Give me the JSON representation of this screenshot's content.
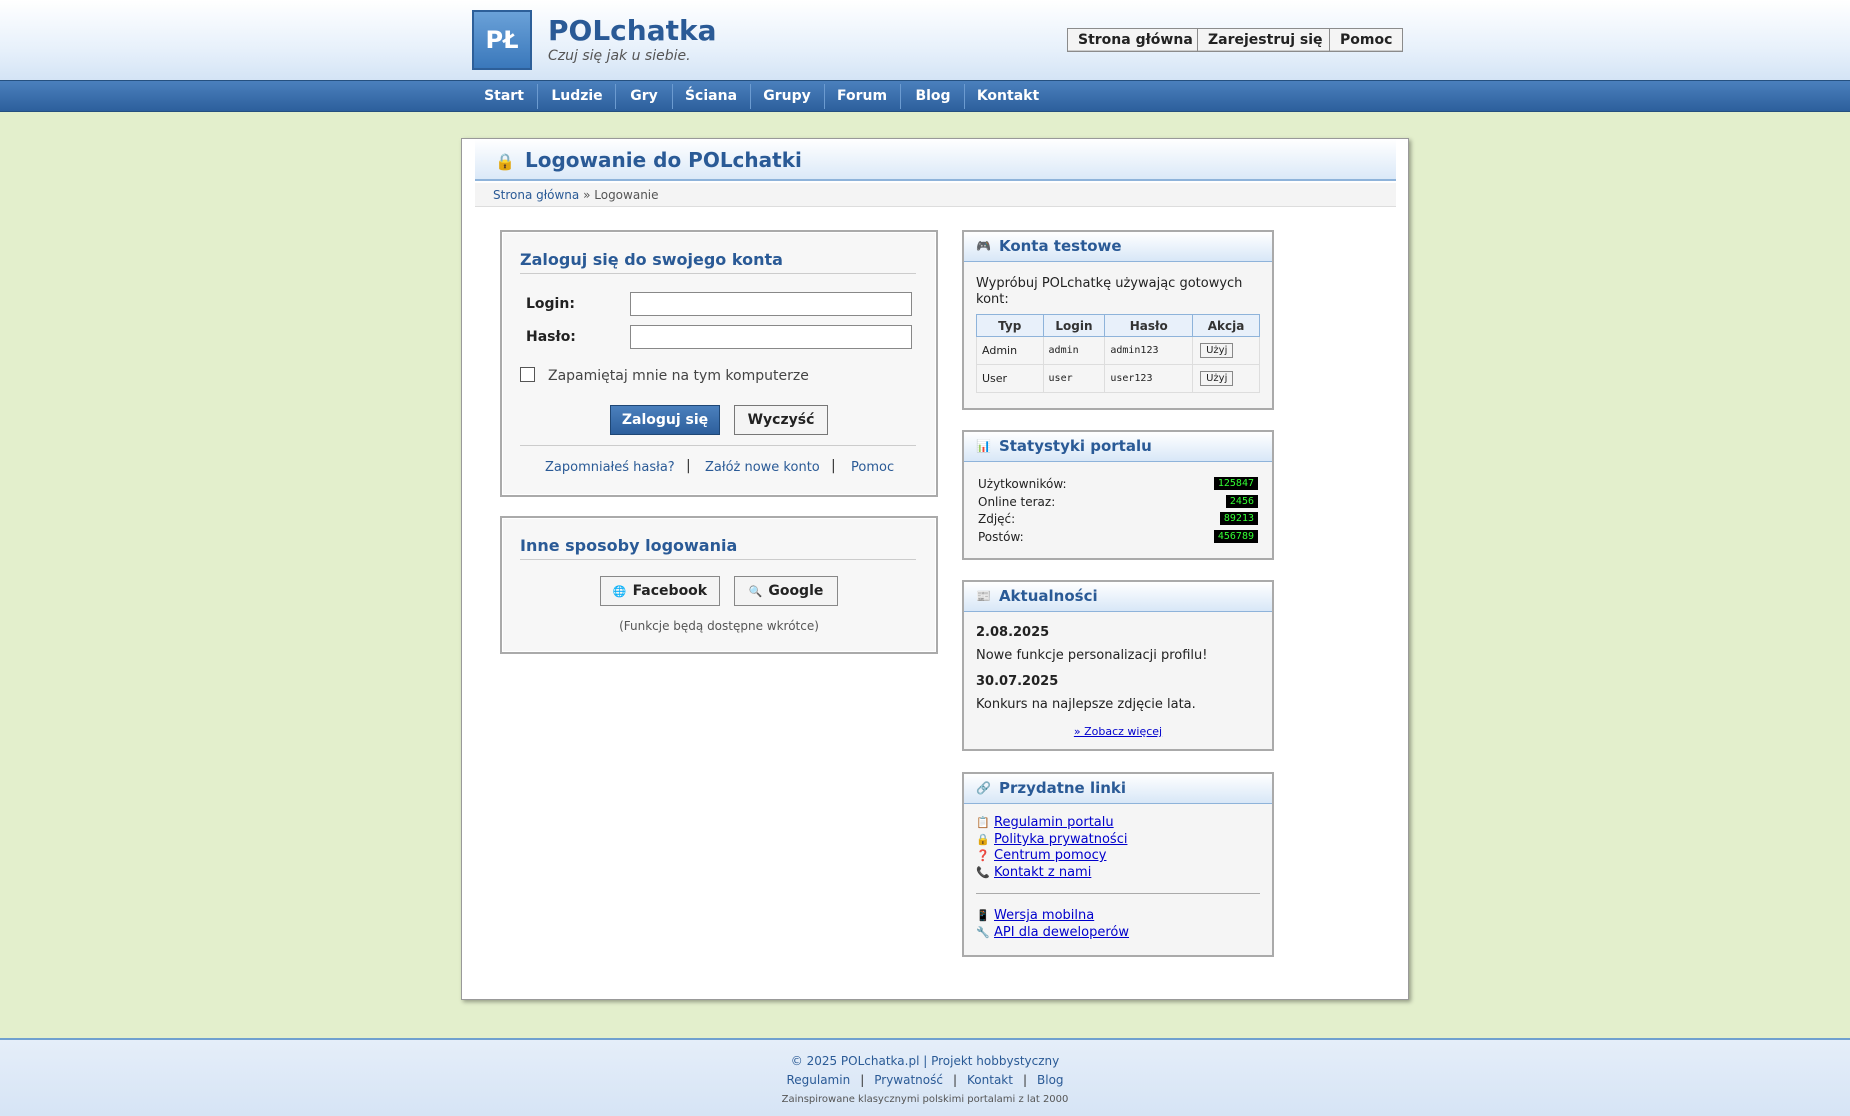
{
  "header": {
    "logo_text": "PŁ",
    "brand": "POLchatka",
    "slogan": "Czuj się jak u siebie.",
    "buttons": [
      "Strona główna",
      "Zarejestruj się",
      "Pomoc"
    ]
  },
  "nav": [
    "Start",
    "Ludzie",
    "Gry",
    "Ściana",
    "Grupy",
    "Forum",
    "Blog",
    "Kontakt"
  ],
  "page": {
    "title_icon": "lock-icon",
    "title": "Logowanie do POLchatki",
    "breadcrumb_home": "Strona główna",
    "breadcrumb_sep": "»",
    "breadcrumb_current": "Logowanie"
  },
  "login": {
    "heading": "Zaloguj się do swojego konta",
    "login_label": "Login:",
    "login_value": "",
    "password_label": "Hasło:",
    "password_value": "",
    "remember_label": "Zapamiętaj mnie na tym komputerze",
    "remember_checked": false,
    "submit": "Zaloguj się",
    "clear": "Wyczyść",
    "links": [
      "Zapomniałeś hasła?",
      "Załóż nowe konto",
      "Pomoc"
    ],
    "link_sep": "|"
  },
  "other_login": {
    "heading": "Inne sposoby logowania",
    "facebook": "Facebook",
    "google": "Google",
    "note": "(Funkcje będą dostępne wkrótce)"
  },
  "test_accounts": {
    "heading": "Konta testowe",
    "icon": "gamepad-icon",
    "intro": "Wypróbuj POLchatkę używając gotowych kont:",
    "columns": [
      "Typ",
      "Login",
      "Hasło",
      "Akcja"
    ],
    "rows": [
      {
        "type": "Admin",
        "login": "admin",
        "password": "admin123",
        "action": "Użyj"
      },
      {
        "type": "User",
        "login": "user",
        "password": "user123",
        "action": "Użyj"
      }
    ]
  },
  "stats": {
    "heading": "Statystyki portalu",
    "icon": "bar-chart-icon",
    "items": [
      {
        "label": "Użytkowników:",
        "value": "125847"
      },
      {
        "label": "Online teraz:",
        "value": "2456"
      },
      {
        "label": "Zdjęć:",
        "value": "89213"
      },
      {
        "label": "Postów:",
        "value": "456789"
      }
    ]
  },
  "news": {
    "heading": "Aktualności",
    "icon": "newspaper-icon",
    "items": [
      {
        "date": "2.08.2025",
        "text": "Nowe funkcje personalizacji profilu!"
      },
      {
        "date": "30.07.2025",
        "text": "Konkurs na najlepsze zdjęcie lata."
      }
    ],
    "more": "» Zobacz więcej"
  },
  "links": {
    "heading": "Przydatne linki",
    "icon": "link-icon",
    "primary": [
      {
        "icon": "📋",
        "label": "Regulamin portalu"
      },
      {
        "icon": "🔒",
        "label": "Polityka prywatności"
      },
      {
        "icon": "❓",
        "label": "Centrum pomocy"
      },
      {
        "icon": "📞",
        "label": "Kontakt z nami"
      }
    ],
    "secondary": [
      {
        "icon": "📱",
        "label": "Wersja mobilna"
      },
      {
        "icon": "🔧",
        "label": "API dla deweloperów"
      }
    ]
  },
  "footer": {
    "copyright": "© 2025 POLchatka.pl | Projekt hobbystyczny",
    "links": [
      "Regulamin",
      "Prywatność",
      "Kontakt",
      "Blog"
    ],
    "link_sep": "|",
    "note": "Zainspirowane klasycznymi polskimi portalami z lat 2000"
  },
  "colors": {
    "brand_blue": "#2a5a96",
    "nav_blue": "#3a6eab",
    "page_bg": "#e3efcc",
    "counter_green": "#33ff33"
  }
}
